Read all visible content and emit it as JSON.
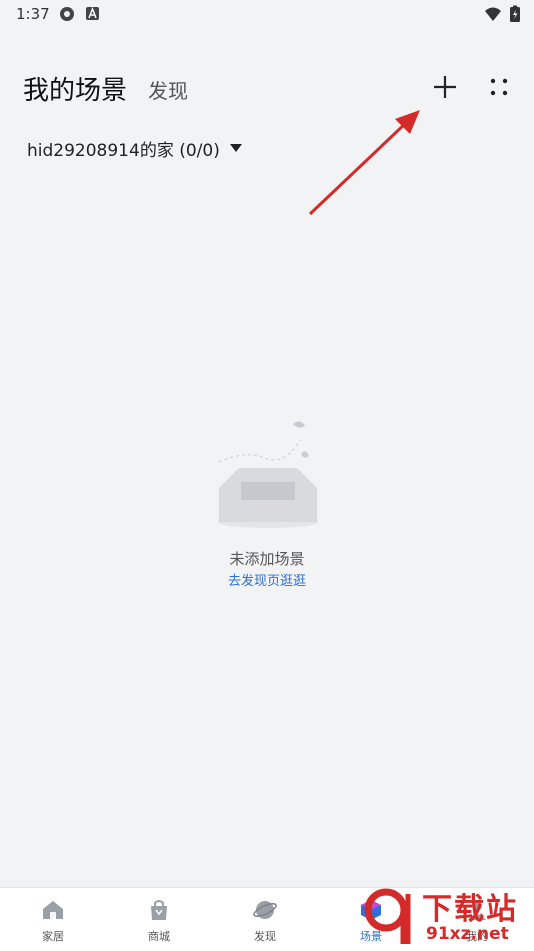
{
  "status_bar": {
    "time": "1:37",
    "icons": [
      "settings-cog-icon",
      "a-badge-icon",
      "wifi-icon",
      "battery-charging-icon"
    ]
  },
  "header": {
    "tab_active": "我的场景",
    "tab_inactive": "发现",
    "add_icon": "plus-icon",
    "more_icon": "grid-dots-icon"
  },
  "home_selector": {
    "label": "hid29208914的家 (0/0)"
  },
  "empty_state": {
    "illustration": "empty-box-icon",
    "message": "未添加场景",
    "link": "去发现页逛逛"
  },
  "bottom_nav": {
    "items": [
      {
        "label": "家居",
        "icon": "home-icon"
      },
      {
        "label": "商城",
        "icon": "shopping-bag-icon"
      },
      {
        "label": "发现",
        "icon": "planet-icon"
      },
      {
        "label": "场景",
        "icon": "scene-cube-icon"
      },
      {
        "label": "我的",
        "icon": "user-icon"
      }
    ],
    "active_index": 3
  },
  "watermark": {
    "big": "下载站",
    "small": "91xz.net"
  },
  "colors": {
    "background": "#f2f3f5",
    "accent": "#2f6fd6",
    "annotation": "#d52a2a"
  }
}
